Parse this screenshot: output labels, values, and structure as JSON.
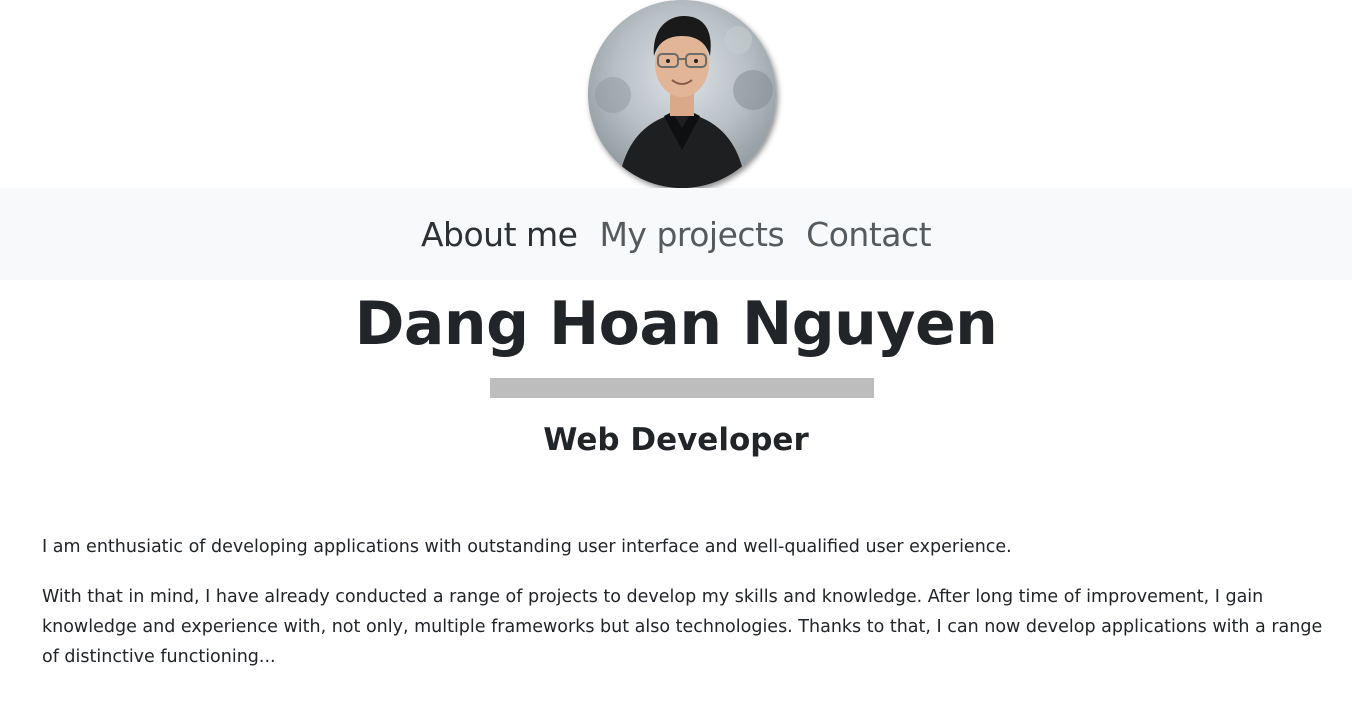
{
  "avatar": {
    "alt": "Profile photo"
  },
  "nav": {
    "items": [
      {
        "label": "About me"
      },
      {
        "label": "My projects"
      },
      {
        "label": "Contact"
      }
    ]
  },
  "hero": {
    "name": "Dang Hoan Nguyen",
    "role": "Web Developer"
  },
  "about": {
    "paragraphs": [
      "I am enthusiatic of developing applications with outstanding user interface and well-qualified user experience.",
      "With that in mind, I have already conducted a range of projects to develop my skills and knowledge. After long time of improvement, I gain knowledge and experience with, not only, multiple frameworks but also technologies. Thanks to that, I can now develop applications with a range of distinctive functioning..."
    ]
  },
  "colors": {
    "navbar_bg": "#f8f9fa",
    "text": "#212529",
    "divider": "#bdbdbd"
  }
}
